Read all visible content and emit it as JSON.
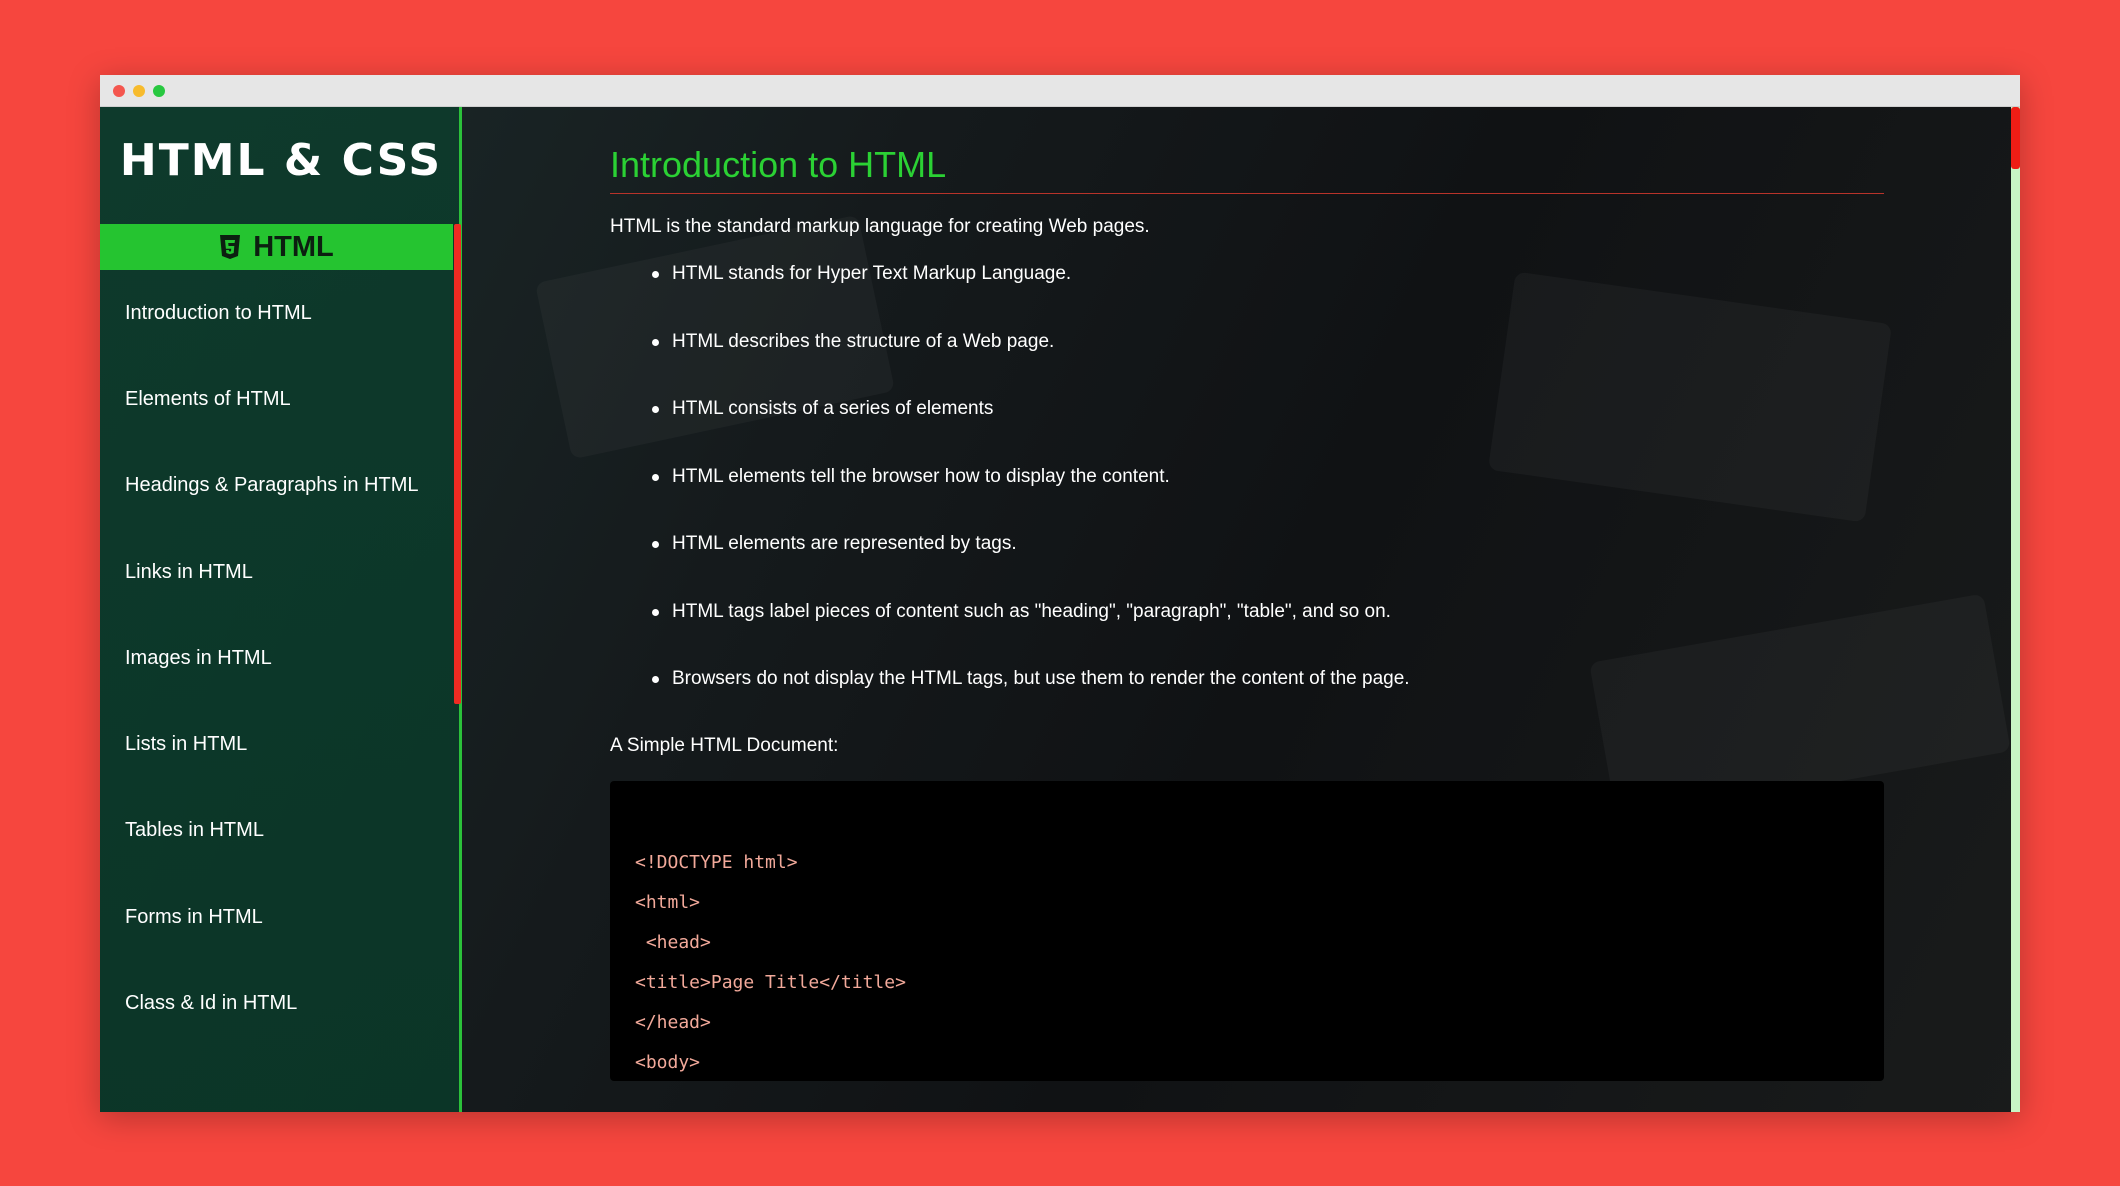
{
  "app": {
    "title": "HTML & CSS"
  },
  "sidebar": {
    "section_label": "HTML",
    "section_icon": "html5-icon",
    "items": [
      {
        "label": "Introduction to HTML"
      },
      {
        "label": "Elements of HTML"
      },
      {
        "label": "Headings & Paragraphs in HTML"
      },
      {
        "label": "Links in HTML"
      },
      {
        "label": "Images in HTML"
      },
      {
        "label": "Lists in HTML"
      },
      {
        "label": "Tables in HTML"
      },
      {
        "label": "Forms in HTML"
      },
      {
        "label": "Class & Id in HTML"
      }
    ]
  },
  "main": {
    "title": "Introduction to HTML",
    "intro": "HTML is the standard markup language for creating Web pages.",
    "bullets": [
      "HTML stands for Hyper Text Markup Language.",
      "HTML describes the structure of a Web page.",
      "HTML consists of a series of elements",
      "HTML elements tell the browser how to display the content.",
      "HTML elements are represented by tags.",
      "HTML tags label pieces of content such as \"heading\", \"paragraph\", \"table\", and so on.",
      "Browsers do not display the HTML tags, but use them to render the content of the page."
    ],
    "doc_label": "A Simple HTML Document:",
    "code_lines": [
      "<!DOCTYPE html>",
      "<html>",
      " <head>",
      "<title>Page Title</title>",
      "</head>",
      "<body>"
    ]
  },
  "colors": {
    "page_background": "#f6463e",
    "accent_green": "#25c430",
    "heading_green": "#2bd134",
    "scroll_red": "#ef2b22",
    "code_text": "#f2a99a"
  }
}
